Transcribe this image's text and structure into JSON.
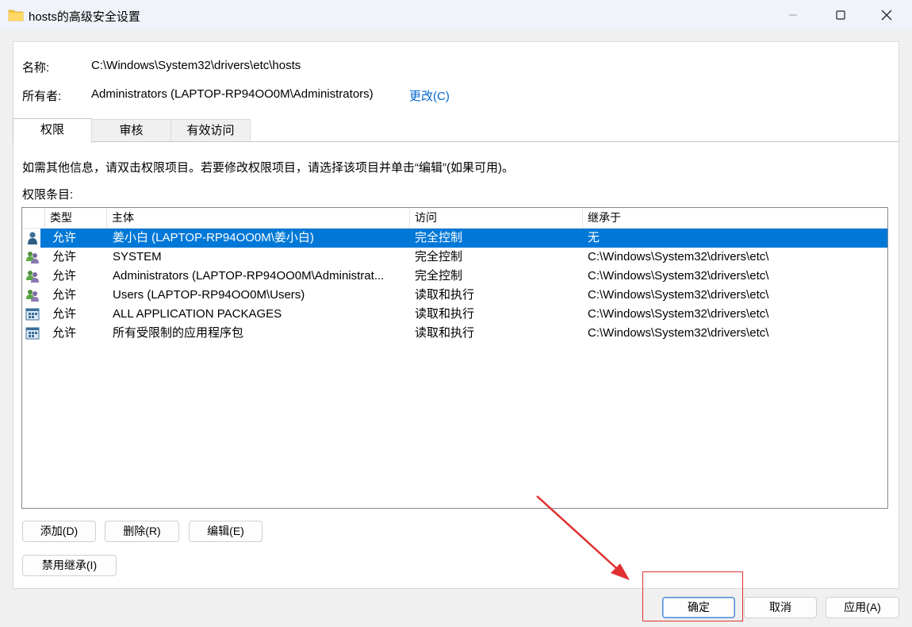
{
  "window": {
    "title": "hosts的高级安全设置",
    "controls": [
      "minimize-icon",
      "maximize-icon",
      "close-icon"
    ]
  },
  "info": {
    "name_label": "名称:",
    "name_value": "C:\\Windows\\System32\\drivers\\etc\\hosts",
    "owner_label": "所有者:",
    "owner_value": "Administrators (LAPTOP-RP94OO0M\\Administrators)",
    "change_link": "更改(C)"
  },
  "tabs": [
    {
      "label": "权限",
      "active": true
    },
    {
      "label": "审核",
      "active": false
    },
    {
      "label": "有效访问",
      "active": false
    }
  ],
  "permissions": {
    "hint": "如需其他信息，请双击权限项目。若要修改权限项目，请选择该项目并单击“编辑”(如果可用)。",
    "list_label": "权限条目:",
    "columns": [
      "类型",
      "主体",
      "访问",
      "继承于"
    ],
    "rows": [
      {
        "icon": "user-icon",
        "type": "允许",
        "principal": "姜小白 (LAPTOP-RP94OO0M\\姜小白)",
        "access": "完全控制",
        "inherited": "无",
        "selected": true
      },
      {
        "icon": "group-icon",
        "type": "允许",
        "principal": "SYSTEM",
        "access": "完全控制",
        "inherited": "C:\\Windows\\System32\\drivers\\etc\\",
        "selected": false
      },
      {
        "icon": "group-icon",
        "type": "允许",
        "principal": "Administrators (LAPTOP-RP94OO0M\\Administrat...",
        "access": "完全控制",
        "inherited": "C:\\Windows\\System32\\drivers\\etc\\",
        "selected": false
      },
      {
        "icon": "group-icon",
        "type": "允许",
        "principal": "Users (LAPTOP-RP94OO0M\\Users)",
        "access": "读取和执行",
        "inherited": "C:\\Windows\\System32\\drivers\\etc\\",
        "selected": false
      },
      {
        "icon": "app-package-icon",
        "type": "允许",
        "principal": "ALL APPLICATION PACKAGES",
        "access": "读取和执行",
        "inherited": "C:\\Windows\\System32\\drivers\\etc\\",
        "selected": false
      },
      {
        "icon": "app-package-icon",
        "type": "允许",
        "principal": "所有受限制的应用程序包",
        "access": "读取和执行",
        "inherited": "C:\\Windows\\System32\\drivers\\etc\\",
        "selected": false
      }
    ]
  },
  "actions": {
    "add": "添加(D)",
    "remove": "删除(R)",
    "edit": "编辑(E)",
    "disable_inheritance": "禁用继承(I)"
  },
  "footer": {
    "ok": "确定",
    "cancel": "取消",
    "apply": "应用(A)"
  },
  "colors": {
    "selection": "#0078d7",
    "link": "#0066cc",
    "annotation": "#e03030"
  }
}
